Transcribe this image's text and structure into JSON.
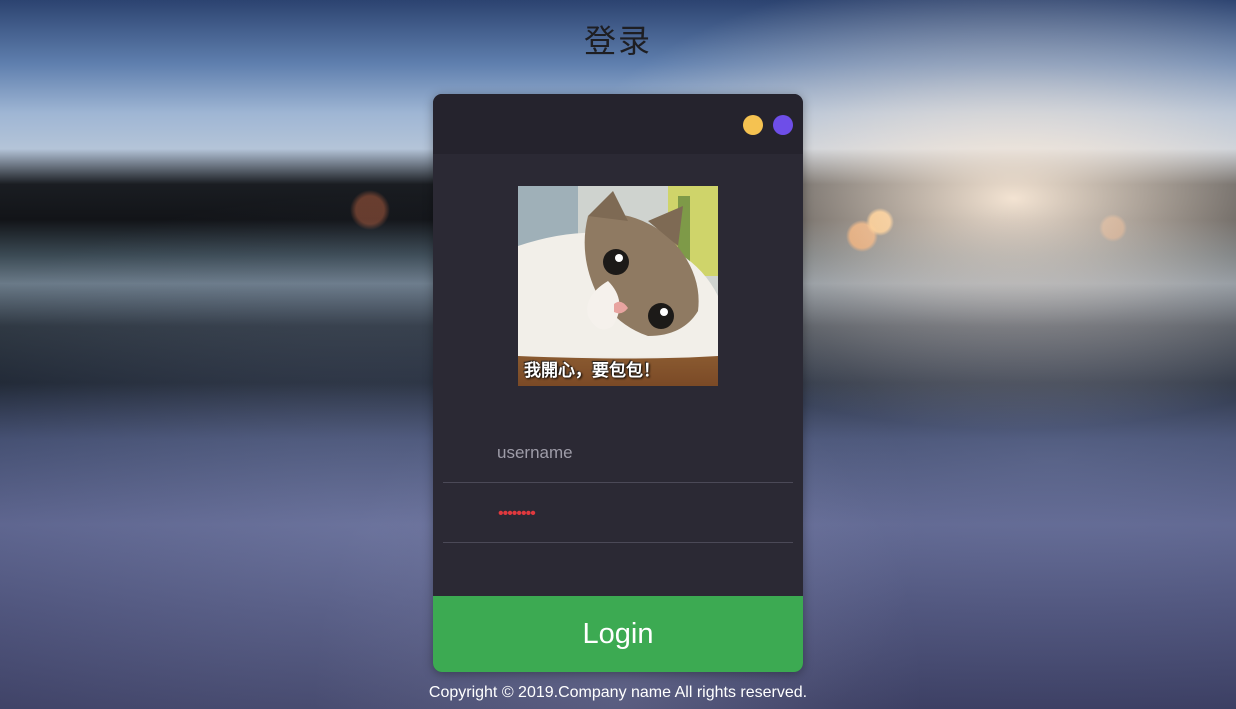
{
  "page": {
    "title": "登录"
  },
  "card": {
    "window_dots": [
      {
        "name": "yellow-dot",
        "color": "#f5c251"
      },
      {
        "name": "purple-dot",
        "color": "#6e4ee8"
      }
    ],
    "avatar": {
      "icon": "cat-photo",
      "caption": "我開心，要包包！"
    }
  },
  "form": {
    "username": {
      "placeholder": "username",
      "value": ""
    },
    "password": {
      "masked_value": "••••••••",
      "mask_color": "#e0393e"
    },
    "login_label": "Login",
    "login_color": "#3caa52"
  },
  "footer": {
    "copyright": "Copyright © 2019.Company name All rights reserved."
  }
}
